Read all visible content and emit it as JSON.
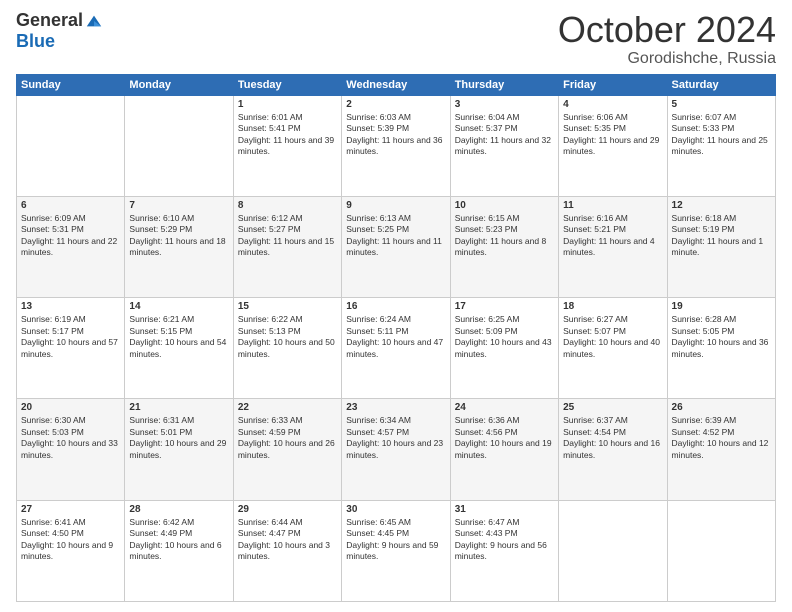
{
  "header": {
    "logo_general": "General",
    "logo_blue": "Blue",
    "month": "October 2024",
    "location": "Gorodishche, Russia"
  },
  "weekdays": [
    "Sunday",
    "Monday",
    "Tuesday",
    "Wednesday",
    "Thursday",
    "Friday",
    "Saturday"
  ],
  "weeks": [
    [
      {
        "day": "",
        "sunrise": "",
        "sunset": "",
        "daylight": ""
      },
      {
        "day": "",
        "sunrise": "",
        "sunset": "",
        "daylight": ""
      },
      {
        "day": "1",
        "sunrise": "Sunrise: 6:01 AM",
        "sunset": "Sunset: 5:41 PM",
        "daylight": "Daylight: 11 hours and 39 minutes."
      },
      {
        "day": "2",
        "sunrise": "Sunrise: 6:03 AM",
        "sunset": "Sunset: 5:39 PM",
        "daylight": "Daylight: 11 hours and 36 minutes."
      },
      {
        "day": "3",
        "sunrise": "Sunrise: 6:04 AM",
        "sunset": "Sunset: 5:37 PM",
        "daylight": "Daylight: 11 hours and 32 minutes."
      },
      {
        "day": "4",
        "sunrise": "Sunrise: 6:06 AM",
        "sunset": "Sunset: 5:35 PM",
        "daylight": "Daylight: 11 hours and 29 minutes."
      },
      {
        "day": "5",
        "sunrise": "Sunrise: 6:07 AM",
        "sunset": "Sunset: 5:33 PM",
        "daylight": "Daylight: 11 hours and 25 minutes."
      }
    ],
    [
      {
        "day": "6",
        "sunrise": "Sunrise: 6:09 AM",
        "sunset": "Sunset: 5:31 PM",
        "daylight": "Daylight: 11 hours and 22 minutes."
      },
      {
        "day": "7",
        "sunrise": "Sunrise: 6:10 AM",
        "sunset": "Sunset: 5:29 PM",
        "daylight": "Daylight: 11 hours and 18 minutes."
      },
      {
        "day": "8",
        "sunrise": "Sunrise: 6:12 AM",
        "sunset": "Sunset: 5:27 PM",
        "daylight": "Daylight: 11 hours and 15 minutes."
      },
      {
        "day": "9",
        "sunrise": "Sunrise: 6:13 AM",
        "sunset": "Sunset: 5:25 PM",
        "daylight": "Daylight: 11 hours and 11 minutes."
      },
      {
        "day": "10",
        "sunrise": "Sunrise: 6:15 AM",
        "sunset": "Sunset: 5:23 PM",
        "daylight": "Daylight: 11 hours and 8 minutes."
      },
      {
        "day": "11",
        "sunrise": "Sunrise: 6:16 AM",
        "sunset": "Sunset: 5:21 PM",
        "daylight": "Daylight: 11 hours and 4 minutes."
      },
      {
        "day": "12",
        "sunrise": "Sunrise: 6:18 AM",
        "sunset": "Sunset: 5:19 PM",
        "daylight": "Daylight: 11 hours and 1 minute."
      }
    ],
    [
      {
        "day": "13",
        "sunrise": "Sunrise: 6:19 AM",
        "sunset": "Sunset: 5:17 PM",
        "daylight": "Daylight: 10 hours and 57 minutes."
      },
      {
        "day": "14",
        "sunrise": "Sunrise: 6:21 AM",
        "sunset": "Sunset: 5:15 PM",
        "daylight": "Daylight: 10 hours and 54 minutes."
      },
      {
        "day": "15",
        "sunrise": "Sunrise: 6:22 AM",
        "sunset": "Sunset: 5:13 PM",
        "daylight": "Daylight: 10 hours and 50 minutes."
      },
      {
        "day": "16",
        "sunrise": "Sunrise: 6:24 AM",
        "sunset": "Sunset: 5:11 PM",
        "daylight": "Daylight: 10 hours and 47 minutes."
      },
      {
        "day": "17",
        "sunrise": "Sunrise: 6:25 AM",
        "sunset": "Sunset: 5:09 PM",
        "daylight": "Daylight: 10 hours and 43 minutes."
      },
      {
        "day": "18",
        "sunrise": "Sunrise: 6:27 AM",
        "sunset": "Sunset: 5:07 PM",
        "daylight": "Daylight: 10 hours and 40 minutes."
      },
      {
        "day": "19",
        "sunrise": "Sunrise: 6:28 AM",
        "sunset": "Sunset: 5:05 PM",
        "daylight": "Daylight: 10 hours and 36 minutes."
      }
    ],
    [
      {
        "day": "20",
        "sunrise": "Sunrise: 6:30 AM",
        "sunset": "Sunset: 5:03 PM",
        "daylight": "Daylight: 10 hours and 33 minutes."
      },
      {
        "day": "21",
        "sunrise": "Sunrise: 6:31 AM",
        "sunset": "Sunset: 5:01 PM",
        "daylight": "Daylight: 10 hours and 29 minutes."
      },
      {
        "day": "22",
        "sunrise": "Sunrise: 6:33 AM",
        "sunset": "Sunset: 4:59 PM",
        "daylight": "Daylight: 10 hours and 26 minutes."
      },
      {
        "day": "23",
        "sunrise": "Sunrise: 6:34 AM",
        "sunset": "Sunset: 4:57 PM",
        "daylight": "Daylight: 10 hours and 23 minutes."
      },
      {
        "day": "24",
        "sunrise": "Sunrise: 6:36 AM",
        "sunset": "Sunset: 4:56 PM",
        "daylight": "Daylight: 10 hours and 19 minutes."
      },
      {
        "day": "25",
        "sunrise": "Sunrise: 6:37 AM",
        "sunset": "Sunset: 4:54 PM",
        "daylight": "Daylight: 10 hours and 16 minutes."
      },
      {
        "day": "26",
        "sunrise": "Sunrise: 6:39 AM",
        "sunset": "Sunset: 4:52 PM",
        "daylight": "Daylight: 10 hours and 12 minutes."
      }
    ],
    [
      {
        "day": "27",
        "sunrise": "Sunrise: 6:41 AM",
        "sunset": "Sunset: 4:50 PM",
        "daylight": "Daylight: 10 hours and 9 minutes."
      },
      {
        "day": "28",
        "sunrise": "Sunrise: 6:42 AM",
        "sunset": "Sunset: 4:49 PM",
        "daylight": "Daylight: 10 hours and 6 minutes."
      },
      {
        "day": "29",
        "sunrise": "Sunrise: 6:44 AM",
        "sunset": "Sunset: 4:47 PM",
        "daylight": "Daylight: 10 hours and 3 minutes."
      },
      {
        "day": "30",
        "sunrise": "Sunrise: 6:45 AM",
        "sunset": "Sunset: 4:45 PM",
        "daylight": "Daylight: 9 hours and 59 minutes."
      },
      {
        "day": "31",
        "sunrise": "Sunrise: 6:47 AM",
        "sunset": "Sunset: 4:43 PM",
        "daylight": "Daylight: 9 hours and 56 minutes."
      },
      {
        "day": "",
        "sunrise": "",
        "sunset": "",
        "daylight": ""
      },
      {
        "day": "",
        "sunrise": "",
        "sunset": "",
        "daylight": ""
      }
    ]
  ]
}
